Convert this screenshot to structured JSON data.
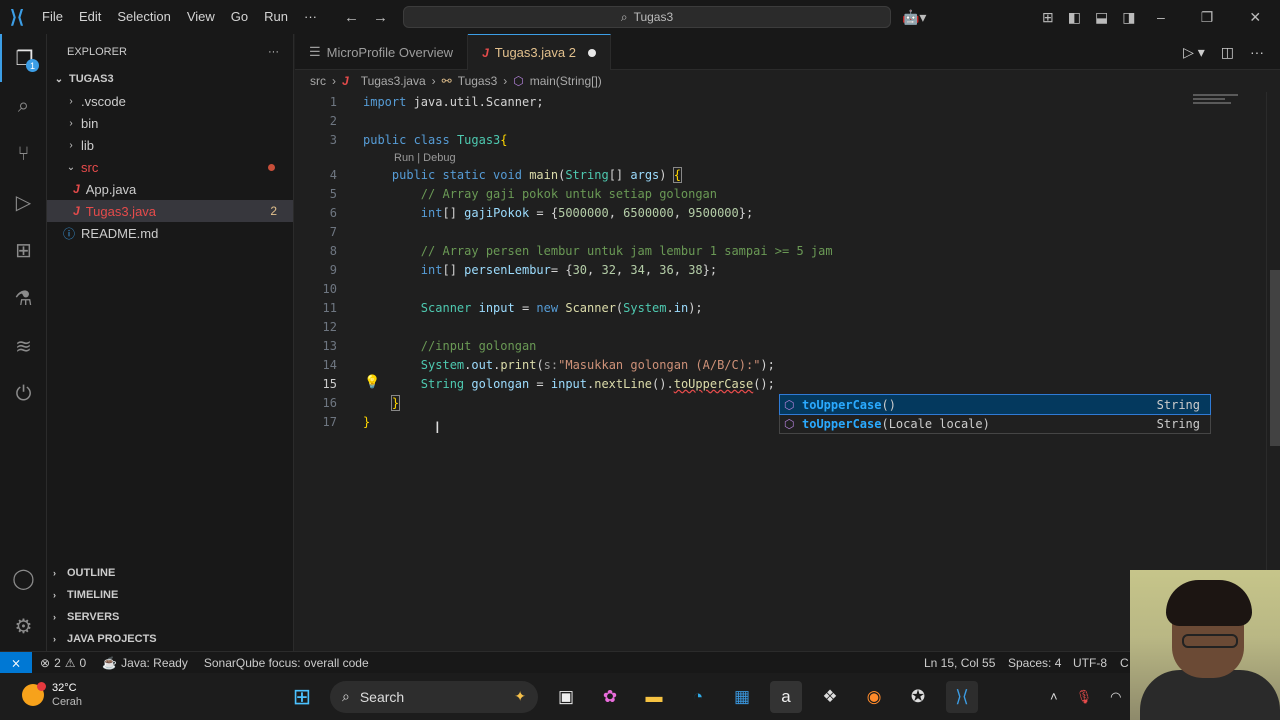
{
  "titlebar": {
    "menu": [
      "File",
      "Edit",
      "Selection",
      "View",
      "Go",
      "Run",
      "···"
    ],
    "command_center": "Tugas3"
  },
  "explorer": {
    "header": "EXPLORER",
    "project": "TUGAS3",
    "items": [
      {
        "label": ".vscode"
      },
      {
        "label": "bin"
      },
      {
        "label": "lib"
      },
      {
        "label": "src"
      },
      {
        "label": "App.java"
      },
      {
        "label": "Tugas3.java",
        "count": "2"
      },
      {
        "label": "README.md"
      }
    ],
    "sections": [
      "OUTLINE",
      "TIMELINE",
      "SERVERS",
      "JAVA PROJECTS"
    ]
  },
  "tabs": [
    {
      "label": "MicroProfile Overview"
    },
    {
      "label": "Tugas3.java 2"
    }
  ],
  "breadcrumb": [
    "src",
    "Tugas3.java",
    "Tugas3",
    "main(String[])"
  ],
  "codelens": "Run | Debug",
  "line_numbers": [
    "1",
    "2",
    "3",
    "4",
    "5",
    "6",
    "7",
    "8",
    "9",
    "10",
    "11",
    "12",
    "13",
    "14",
    "15",
    "16",
    "17"
  ],
  "suggest": [
    {
      "match": "toUpperCase",
      "rest": "()",
      "type": "String"
    },
    {
      "match": "toUpperCase",
      "rest": "(Locale locale)",
      "type": "String"
    }
  ],
  "status": {
    "problems": "2",
    "warnings": "0",
    "java": "Java: Ready",
    "sonar": "SonarQube focus: overall code",
    "position": "Ln 15, Col 55",
    "spaces": "Spaces: 4",
    "encoding": "UTF-8",
    "eol": "C"
  },
  "taskbar": {
    "temperature": "32°C",
    "condition": "Cerah",
    "search": "Search"
  },
  "colors": {
    "accent": "#0078d4",
    "error": "#e64b4b",
    "modified": "#e2c08d"
  }
}
